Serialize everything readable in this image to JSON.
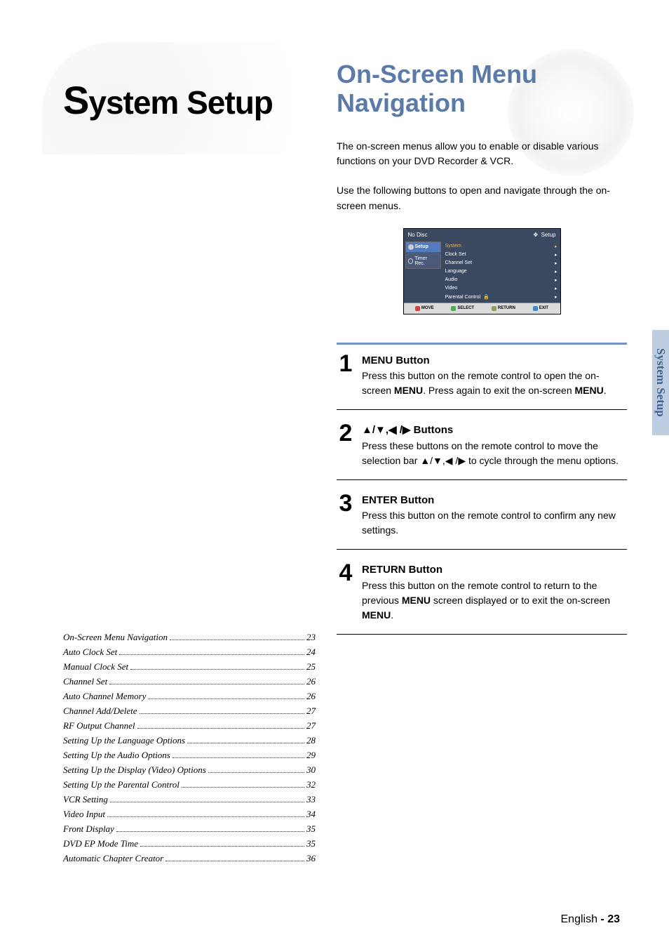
{
  "section_title_prefix_big": "S",
  "section_title_rest": "ystem Setup",
  "right_title": "On-Screen Menu Navigation",
  "intro_line1": "The on-screen menus allow you to enable or disable various functions on your DVD Recorder & VCR.",
  "intro_line2": "Use the following buttons to open and navigate through the on-screen menus.",
  "osd": {
    "top_left": "No Disc",
    "top_right_icon": "✥",
    "top_right": "Setup",
    "tab_setup": "Setup",
    "tab_timer": "Timer Rec.",
    "items": [
      {
        "label": "System",
        "sel": true
      },
      {
        "label": "Clock Set",
        "sel": false
      },
      {
        "label": "Channel Set",
        "sel": false
      },
      {
        "label": "Language",
        "sel": false
      },
      {
        "label": "Audio",
        "sel": false
      },
      {
        "label": "Video",
        "sel": false
      },
      {
        "label": "Parental Control",
        "sel": false,
        "lock": true
      }
    ],
    "bottom": {
      "move": "MOVE",
      "select": "SELECT",
      "return": "RETURN",
      "exit": "EXIT"
    }
  },
  "steps": [
    {
      "num": "1",
      "title": "MENU Button",
      "body_pre": "Press this button on the remote control to open the on-screen ",
      "body_bold1": "MENU",
      "body_mid": ". Press again to exit the on-screen ",
      "body_bold2": "MENU",
      "body_post": "."
    },
    {
      "num": "2",
      "title_prefix_arrows": "▲/▼,◀ /▶",
      "title": " Buttons",
      "body_pre": "Press these buttons on the remote control to move the selection bar ",
      "body_arrows": "▲/▼,◀ /▶",
      "body_post": " to cycle through the menu options."
    },
    {
      "num": "3",
      "title": "ENTER Button",
      "body": "Press this button on the remote control to confirm any new settings."
    },
    {
      "num": "4",
      "title": "RETURN Button",
      "body_pre": "Press this button on the remote control to return to the previous ",
      "body_bold": "MENU",
      "body_post": " screen displayed or to exit the on-screen ",
      "body_bold2": "MENU",
      "body_end": "."
    }
  ],
  "toc": [
    {
      "title": "On-Screen Menu Navigation",
      "page": "23"
    },
    {
      "title": "Auto Clock Set",
      "page": "24"
    },
    {
      "title": "Manual Clock Set",
      "page": "25"
    },
    {
      "title": "Channel Set",
      "page": "26"
    },
    {
      "title": "Auto Channel Memory",
      "page": "26"
    },
    {
      "title": "Channel Add/Delete",
      "page": "27"
    },
    {
      "title": "RF Output Channel",
      "page": "27"
    },
    {
      "title": "Setting Up the Language Options",
      "page": "28"
    },
    {
      "title": "Setting Up the Audio Options",
      "page": "29"
    },
    {
      "title": "Setting Up the Display (Video) Options",
      "page": "30"
    },
    {
      "title": "Setting Up the Parental Control",
      "page": "32"
    },
    {
      "title": "VCR Setting",
      "page": "33"
    },
    {
      "title": "Video Input",
      "page": "34"
    },
    {
      "title": "Front Display",
      "page": "35"
    },
    {
      "title": "DVD EP Mode Time",
      "page": "35"
    },
    {
      "title": "Automatic Chapter Creator",
      "page": "36"
    }
  ],
  "side_tab": "System Setup",
  "footer_lang": "English",
  "footer_sep": " - ",
  "footer_page": "23"
}
